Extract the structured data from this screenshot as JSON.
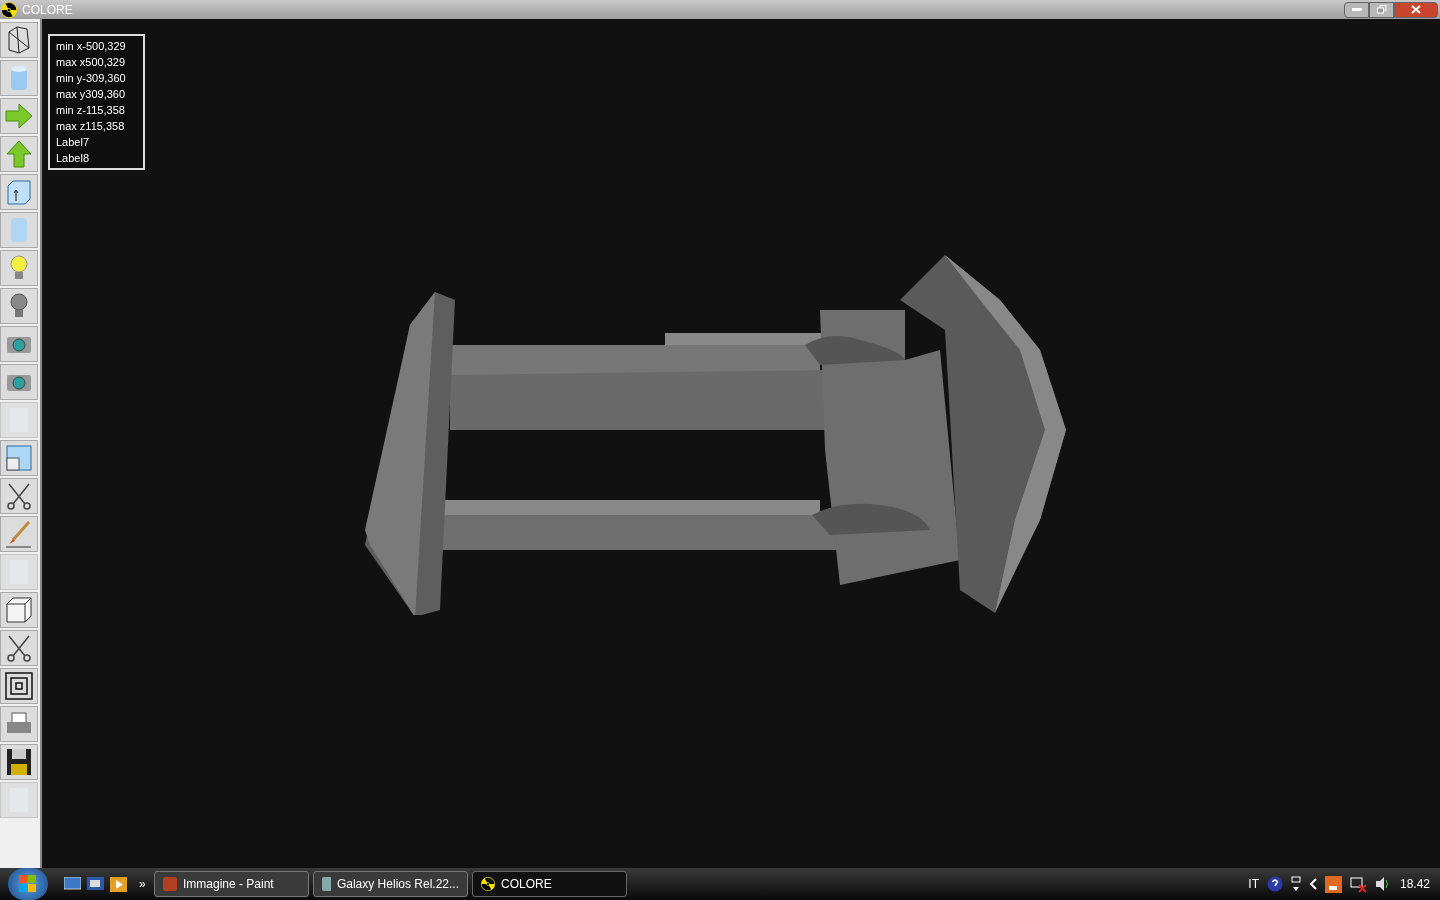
{
  "window": {
    "title": "COLORE"
  },
  "toolbar": [
    {
      "disabled": false
    },
    {
      "disabled": false
    },
    {
      "disabled": false
    },
    {
      "disabled": false
    },
    {
      "disabled": false
    },
    {
      "disabled": false
    },
    {
      "disabled": false
    },
    {
      "disabled": false
    },
    {
      "disabled": false
    },
    {
      "disabled": false
    },
    {
      "disabled": true
    },
    {
      "disabled": false
    },
    {
      "disabled": false
    },
    {
      "disabled": false
    },
    {
      "disabled": true
    },
    {
      "disabled": false
    },
    {
      "disabled": false
    },
    {
      "disabled": false
    },
    {
      "disabled": false
    },
    {
      "disabled": false
    },
    {
      "disabled": true
    }
  ],
  "info_labels": [
    "min x-500,329",
    "max x500,329",
    "min y-309,360",
    "max y309,360",
    "min z-115,358",
    "max z115,358",
    "Label7",
    "Label8"
  ],
  "taskbar": {
    "overflow": "»",
    "tasks": [
      {
        "label": "Immagine - Paint",
        "selected": false
      },
      {
        "label": "Galaxy Helios  Rel.22...",
        "selected": false
      },
      {
        "label": "COLORE",
        "selected": true
      }
    ],
    "language": "IT",
    "clock": "18.42"
  }
}
